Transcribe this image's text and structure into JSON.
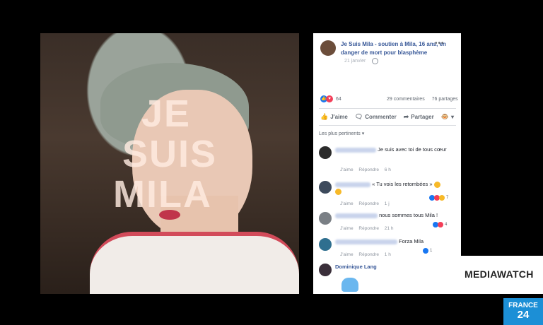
{
  "photo": {
    "overlay_lines": [
      "JE",
      "SUIS",
      "MILA"
    ]
  },
  "post": {
    "title": "Je Suis Mila - soutien à Mila, 16 ans, en danger de mort pour blasphème",
    "date": "21 janvier",
    "reaction_count": "64",
    "comments_count": "29 commentaires",
    "shares_count": "76 partages",
    "actions": [
      {
        "icon": "like-icon",
        "label": "J'aime"
      },
      {
        "icon": "comment-icon",
        "label": "Commenter"
      },
      {
        "icon": "share-icon",
        "label": "Partager"
      }
    ],
    "sort_label": "Les plus pertinents ▾",
    "comments": [
      {
        "text": "Je suis avec toi de tous cœur",
        "like": "J'aime",
        "reply": "Répondre",
        "time": "6 h"
      },
      {
        "text": "« Tu vois les retombées »",
        "like": "J'aime",
        "reply": "Répondre",
        "time": "1 j",
        "reactions": "7"
      },
      {
        "text": "nous sommes tous Mila !",
        "like": "J'aime",
        "reply": "Répondre",
        "time": "21 h",
        "reactions": "4"
      },
      {
        "text": "Forza Mila",
        "like": "J'aime",
        "reply": "Répondre",
        "time": "1 h",
        "reactions": "1"
      },
      {
        "author": "Dominique Lang"
      }
    ]
  },
  "brand": {
    "mediawatch": "MEDIAWATCH",
    "channel_line1": "FRANCE",
    "channel_line2": "24"
  },
  "colors": {
    "fb_blue": "#385898",
    "france24_blue": "#1c8fd6"
  }
}
